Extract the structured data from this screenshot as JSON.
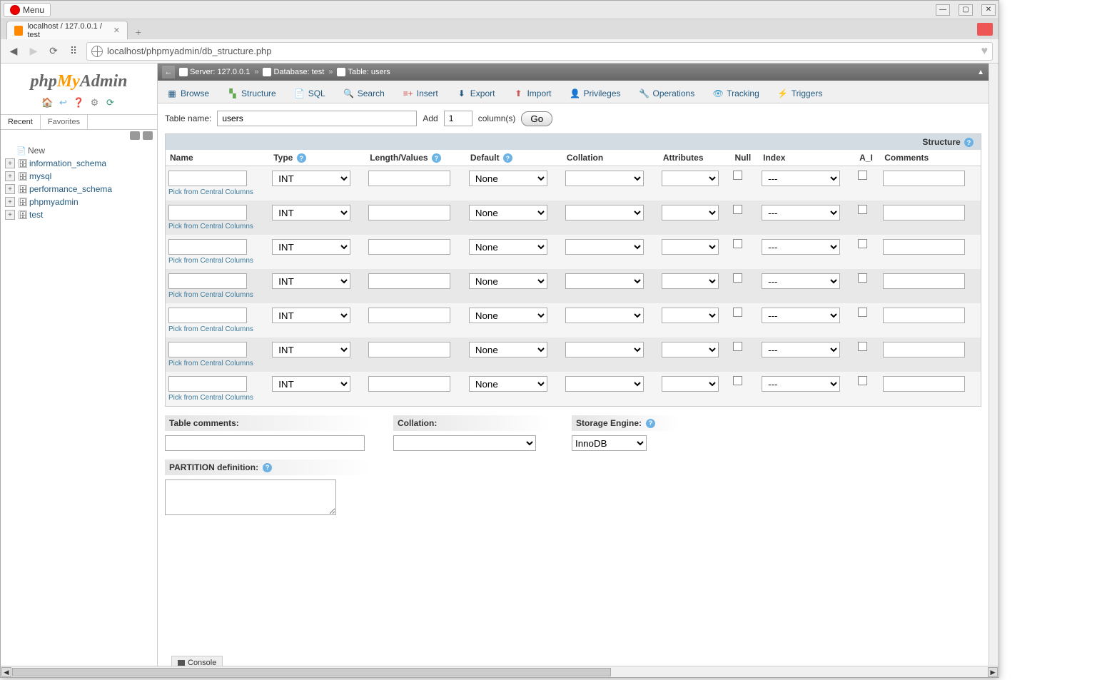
{
  "browser": {
    "menu_label": "Menu",
    "tab_title": "localhost / 127.0.0.1 / test",
    "url": "localhost/phpmyadmin/db_structure.php"
  },
  "sidebar": {
    "logo": {
      "php": "php",
      "my": "My",
      "admin": "Admin"
    },
    "tabs": {
      "recent": "Recent",
      "favorites": "Favorites"
    },
    "tree": {
      "new_label": "New",
      "items": [
        {
          "label": "information_schema"
        },
        {
          "label": "mysql"
        },
        {
          "label": "performance_schema"
        },
        {
          "label": "phpmyadmin"
        },
        {
          "label": "test"
        }
      ]
    }
  },
  "breadcrumb": {
    "server_label": "Server:",
    "server_value": "127.0.0.1",
    "database_label": "Database:",
    "database_value": "test",
    "table_label": "Table:",
    "table_value": "users"
  },
  "main_tabs": [
    {
      "label": "Browse"
    },
    {
      "label": "Structure"
    },
    {
      "label": "SQL"
    },
    {
      "label": "Search"
    },
    {
      "label": "Insert"
    },
    {
      "label": "Export"
    },
    {
      "label": "Import"
    },
    {
      "label": "Privileges"
    },
    {
      "label": "Operations"
    },
    {
      "label": "Tracking"
    },
    {
      "label": "Triggers"
    }
  ],
  "form": {
    "table_name_label": "Table name:",
    "table_name_value": "users",
    "add_label": "Add",
    "add_count": "1",
    "columns_label": "column(s)",
    "go_label": "Go"
  },
  "columns_header": {
    "structure_label": "Structure",
    "name": "Name",
    "type": "Type",
    "length": "Length/Values",
    "default": "Default",
    "collation": "Collation",
    "attributes": "Attributes",
    "null": "Null",
    "index": "Index",
    "ai": "A_I",
    "comments": "Comments"
  },
  "column_row": {
    "pick_link": "Pick from Central Columns",
    "type_value": "INT",
    "default_value": "None",
    "index_value": "---"
  },
  "bottom": {
    "comments_label": "Table comments:",
    "collation_label": "Collation:",
    "engine_label": "Storage Engine:",
    "engine_value": "InnoDB",
    "partition_label": "PARTITION definition:"
  },
  "console_label": "Console"
}
